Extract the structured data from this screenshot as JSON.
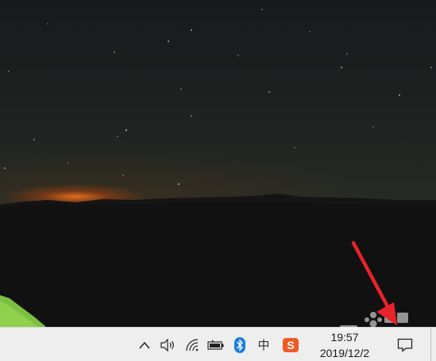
{
  "system_tray": {
    "icons": [
      "chevron-up-icon",
      "volume-icon",
      "wifi-icon",
      "battery-icon",
      "bluetooth-icon",
      "ime-chinese-icon",
      "sogou-icon",
      "action-center-icon"
    ],
    "ime_label": "中",
    "sogou_label": "S",
    "clock": {
      "time": "19:57",
      "date": "2019/12/2"
    }
  },
  "colors": {
    "taskbar": "#eeeeee",
    "bluetooth": "#1a7ee0",
    "sogou": "#f15a24",
    "annotation_arrow": "#e8232a"
  }
}
